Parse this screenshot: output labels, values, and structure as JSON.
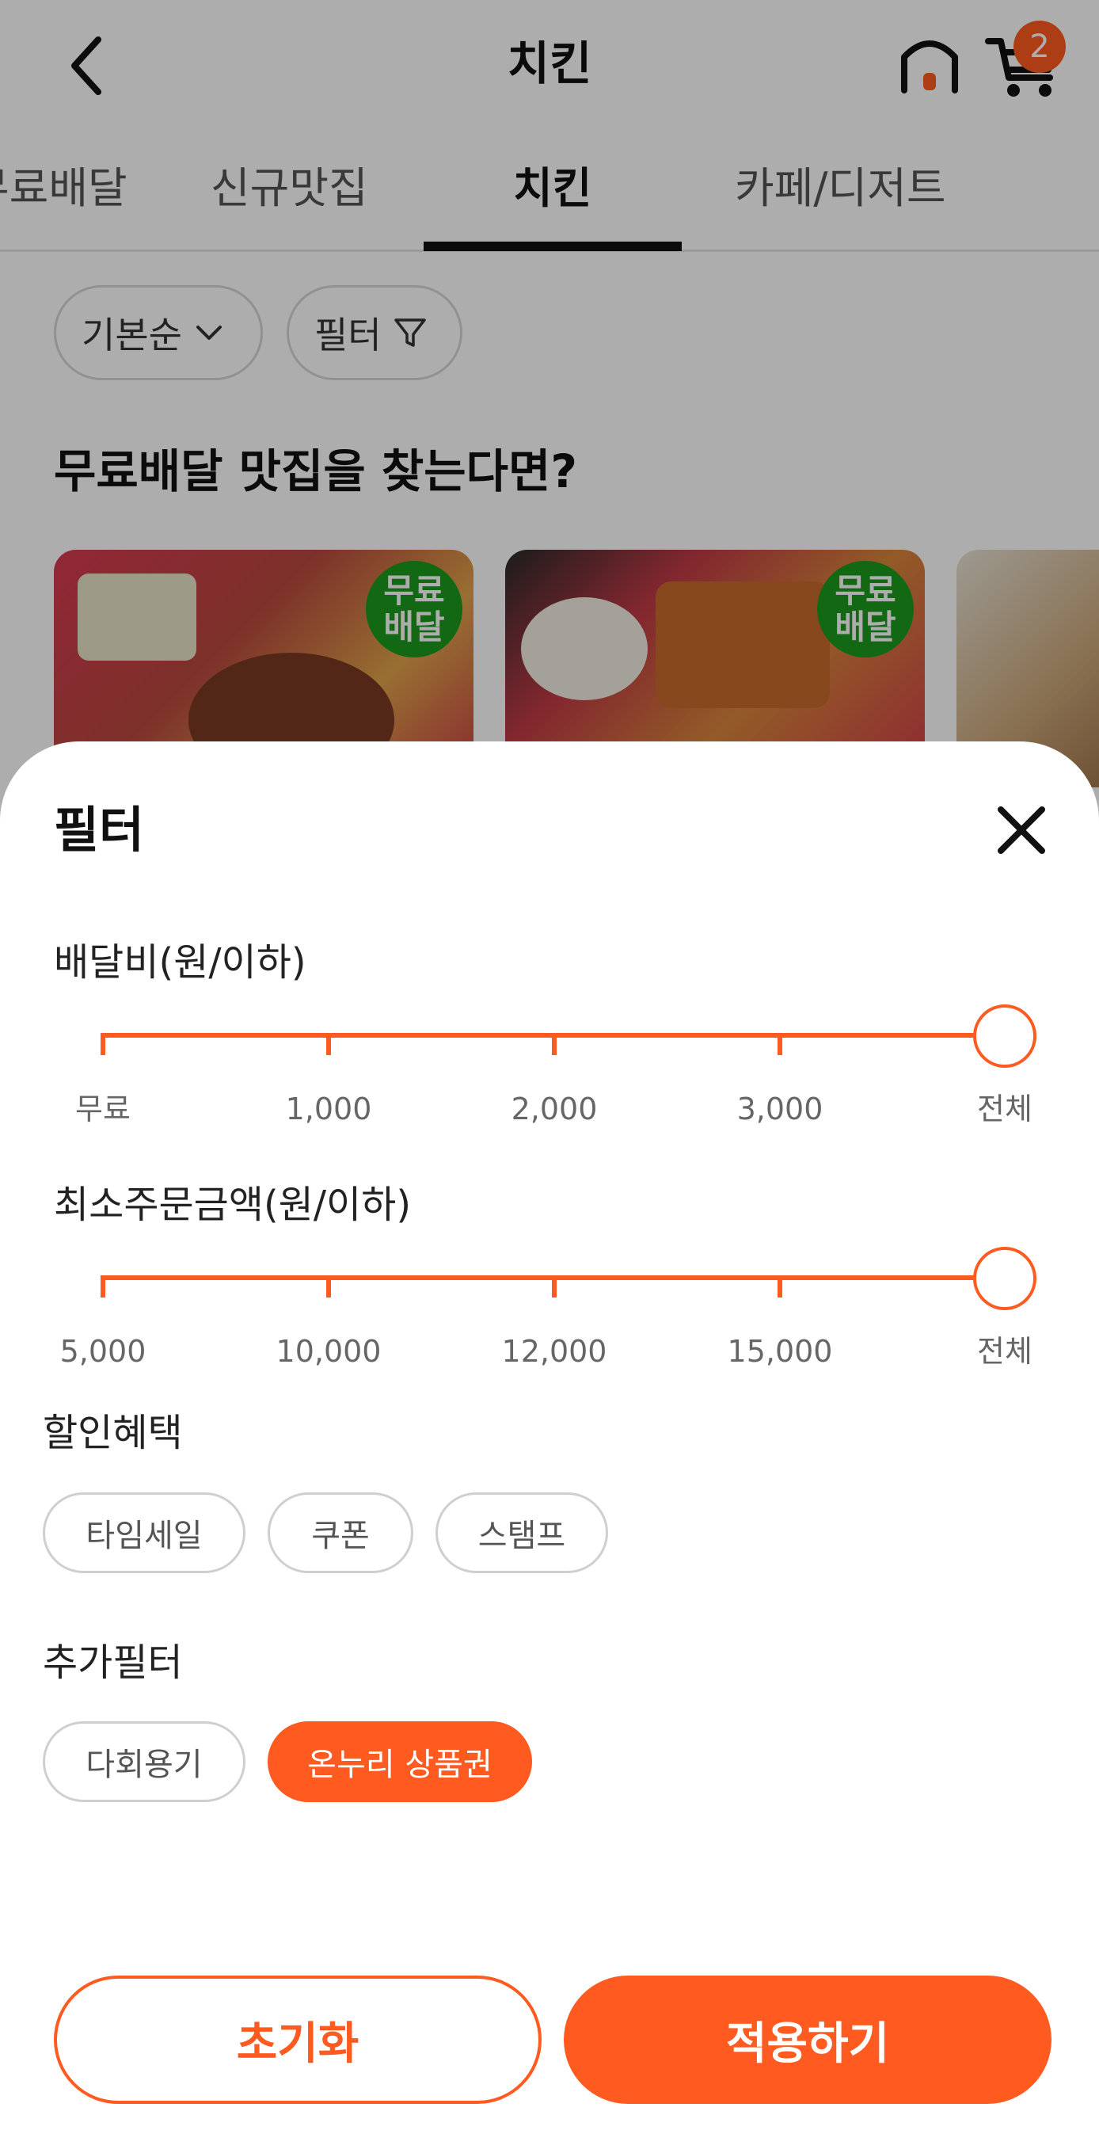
{
  "header": {
    "title": "치킨",
    "cart_count": "2"
  },
  "tabs": [
    {
      "label": "무료배달"
    },
    {
      "label": "신규맛집"
    },
    {
      "label": "치킨"
    },
    {
      "label": "카페/디저트"
    }
  ],
  "sort": {
    "label": "기본순"
  },
  "filter_chip": {
    "label": "필터"
  },
  "section": {
    "title": "무료배달 맛집을 찾는다면?"
  },
  "cards": [
    {
      "badge_top": "무료",
      "badge_bottom": "배달"
    },
    {
      "badge_top": "무료",
      "badge_bottom": "배달"
    },
    {
      "badge_top": "",
      "badge_bottom": ""
    }
  ],
  "sheet": {
    "title": "필터",
    "delivery_fee": {
      "label": "배달비(원/이하)",
      "ticks": [
        "무료",
        "1,000",
        "2,000",
        "3,000",
        "전체"
      ],
      "selected": "전체"
    },
    "min_order": {
      "label": "최소주문금액(원/이하)",
      "ticks": [
        "5,000",
        "10,000",
        "12,000",
        "15,000",
        "전체"
      ],
      "selected": "전체"
    },
    "discount": {
      "label": "할인혜택",
      "options": [
        {
          "label": "타임세일",
          "selected": false
        },
        {
          "label": "쿠폰",
          "selected": false
        },
        {
          "label": "스탬프",
          "selected": false
        }
      ]
    },
    "extra": {
      "label": "추가필터",
      "options": [
        {
          "label": "다회용기",
          "selected": false
        },
        {
          "label": "온누리 상품권",
          "selected": true
        }
      ]
    },
    "reset_label": "초기화",
    "apply_label": "적용하기"
  },
  "colors": {
    "accent": "#ff5a1f",
    "badge_green": "#1d9b1d",
    "dim_overlay": "rgba(0,0,0,0.32)"
  }
}
